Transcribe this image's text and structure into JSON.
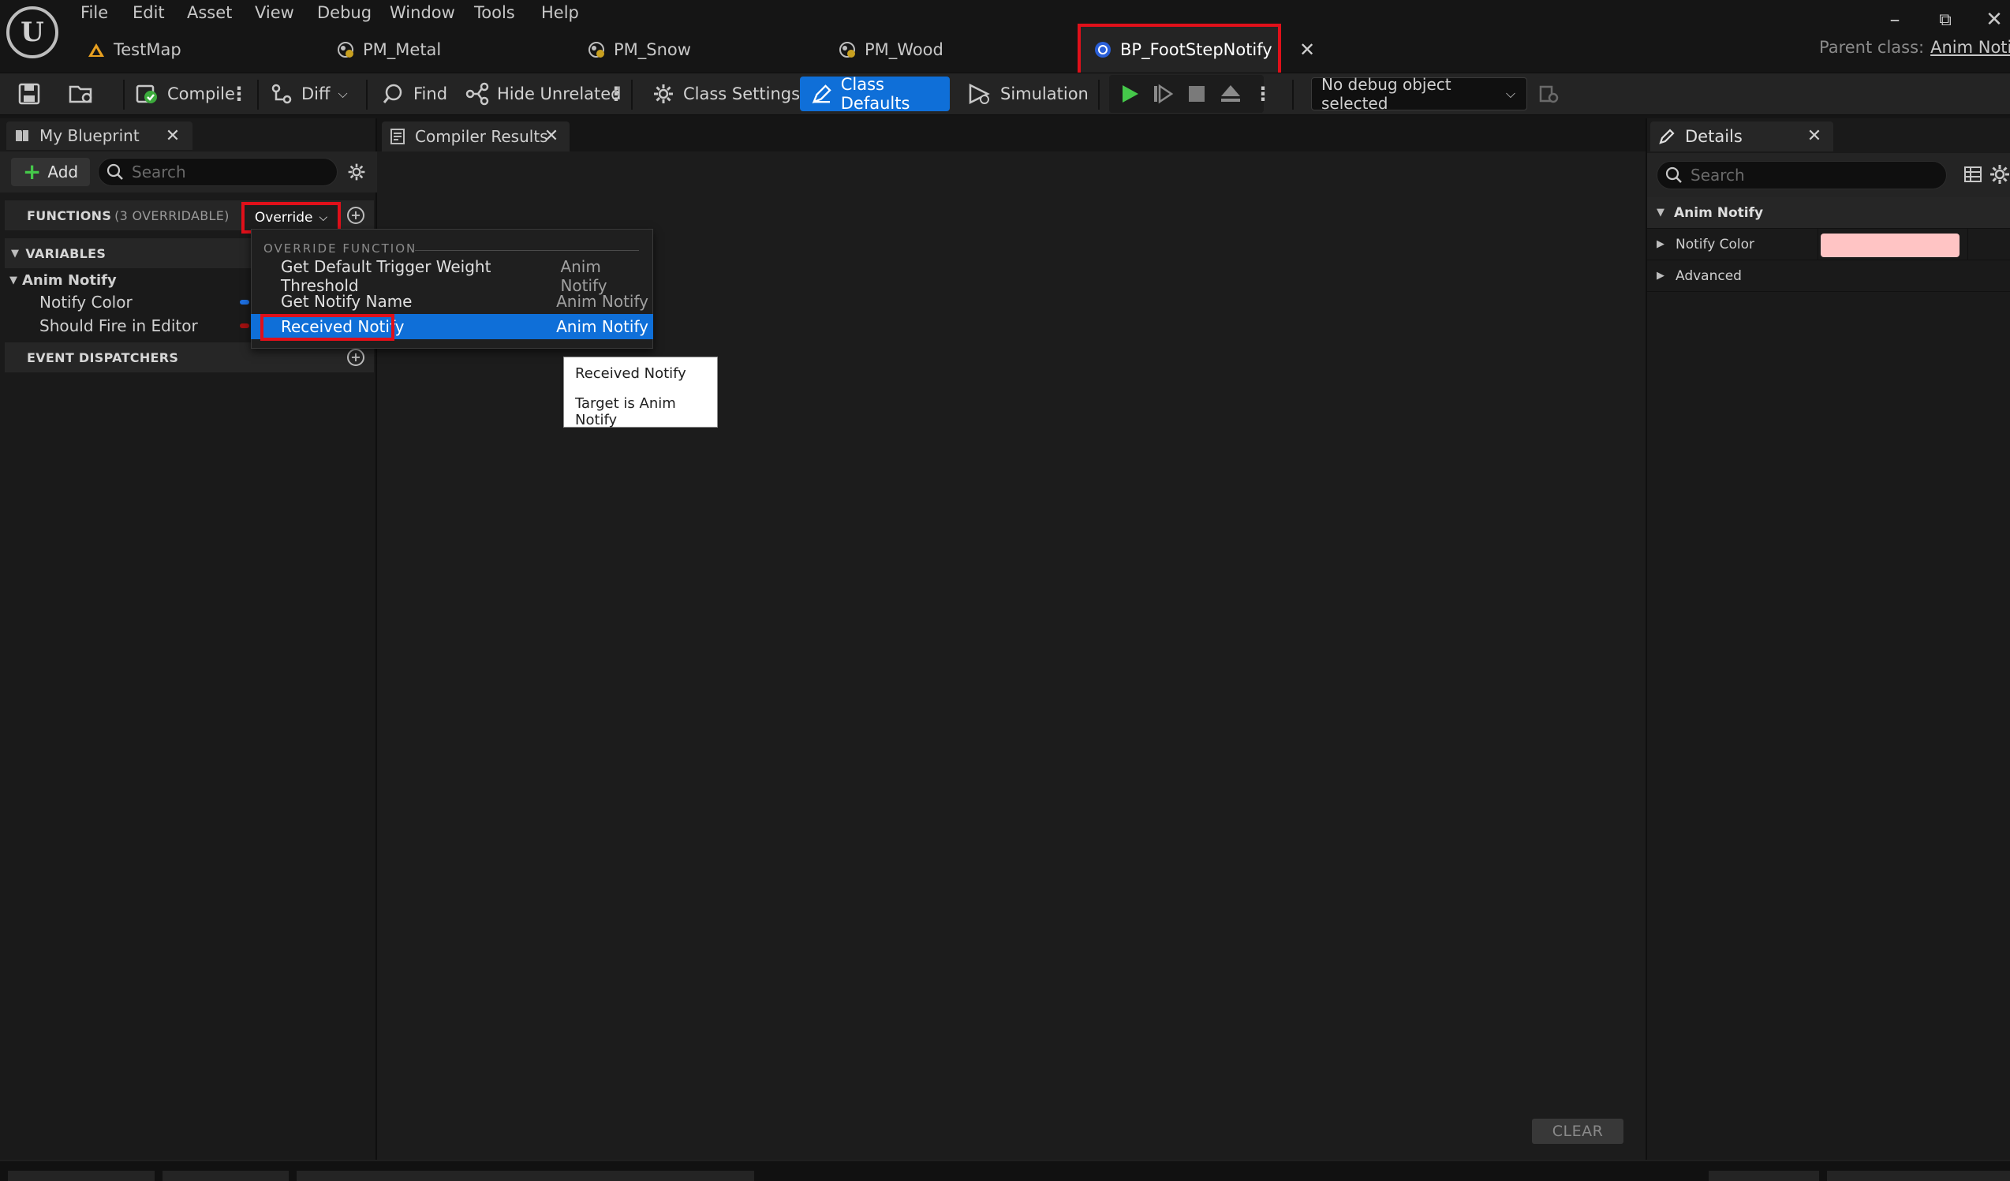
{
  "menu": [
    "File",
    "Edit",
    "Asset",
    "View",
    "Debug",
    "Window",
    "Tools",
    "Help"
  ],
  "doc_tabs": [
    {
      "label": "TestMap",
      "icon": "level-icon"
    },
    {
      "label": "PM_Metal",
      "icon": "physical-material-icon"
    },
    {
      "label": "PM_Snow",
      "icon": "physical-material-icon"
    },
    {
      "label": "PM_Wood",
      "icon": "physical-material-icon"
    },
    {
      "label": "BP_FootStepNotify",
      "icon": "blueprint-icon",
      "active": true
    }
  ],
  "parent_class": {
    "label": "Parent class:",
    "value": "Anim Notify"
  },
  "toolbar": {
    "compile": "Compile",
    "diff": "Diff",
    "find": "Find",
    "hide_unrelated": "Hide Unrelated",
    "class_settings": "Class Settings",
    "class_defaults": "Class Defaults",
    "simulation": "Simulation",
    "debug_object": "No debug object selected"
  },
  "my_blueprint": {
    "tab_label": "My Blueprint",
    "add_label": "Add",
    "search_placeholder": "Search",
    "functions_label": "FUNCTIONS",
    "functions_sub": "(3 OVERRIDABLE)",
    "override_label": "Override",
    "variables_label": "VARIABLES",
    "var_category": "Anim Notify",
    "variables": [
      {
        "name": "Notify Color",
        "pin_color": "#1d6fe0"
      },
      {
        "name": "Should Fire in Editor",
        "pin_color": "#a01010"
      }
    ],
    "event_dispatchers_label": "EVENT DISPATCHERS"
  },
  "override_menu": {
    "header": "OVERRIDE FUNCTION",
    "items": [
      {
        "label": "Get Default Trigger Weight Threshold",
        "category": "Anim Notify"
      },
      {
        "label": "Get Notify Name",
        "category": "Anim Notify"
      },
      {
        "label": "Received Notify",
        "category": "Anim Notify",
        "selected": true
      }
    ]
  },
  "tooltip": {
    "line1": "Received Notify",
    "line2": "Target is Anim Notify"
  },
  "compiler_results": {
    "tab_label": "Compiler Results",
    "clear_label": "CLEAR"
  },
  "details": {
    "tab_label": "Details",
    "search_placeholder": "Search",
    "category": "Anim Notify",
    "rows": [
      {
        "label": "Notify Color",
        "color": "#ffc4c4"
      },
      {
        "label": "Advanced"
      }
    ]
  },
  "colors": {
    "accent": "#0f6fd8",
    "highlight_box": "#e0101a",
    "play_green": "#45c84a"
  }
}
